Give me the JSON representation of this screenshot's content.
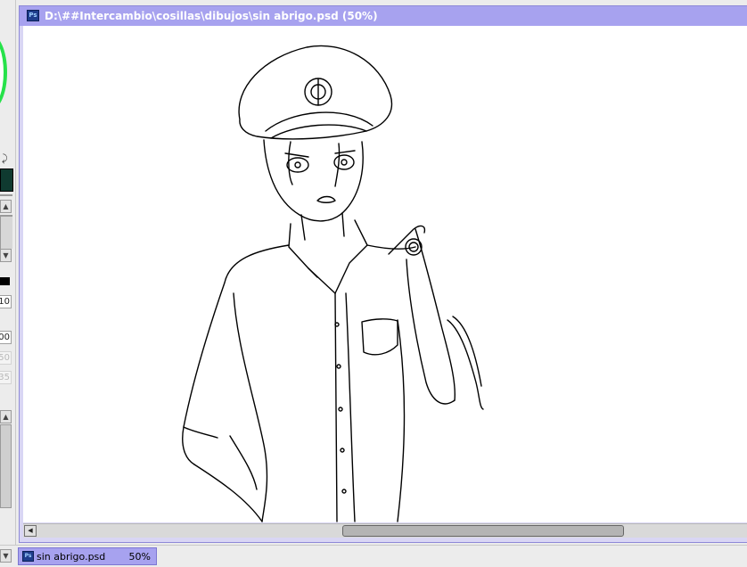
{
  "window": {
    "title": "D:\\##Intercambio\\cosillas\\dibujos\\sin abrigo.psd (50%)",
    "app_icon": "ps-icon",
    "icon_label": "Ps"
  },
  "left_panel": {
    "icons": [
      "color-wheel",
      "swap-colors-icon",
      "up-arrow-icon",
      "down-arrow-icon"
    ],
    "foreground_color": "#0f3a30",
    "swatch_color": "#000000",
    "values": [
      "10",
      "00",
      "50",
      "35"
    ]
  },
  "scrollbar": {
    "icons": [
      "left-arrow-icon"
    ]
  },
  "taskbar": {
    "item_name": "sin abrigo.psd",
    "item_zoom": "50%"
  },
  "colors": {
    "title_bar": "#a7a2ef",
    "window_border": "#8e89d8",
    "canvas": "#ffffff"
  }
}
